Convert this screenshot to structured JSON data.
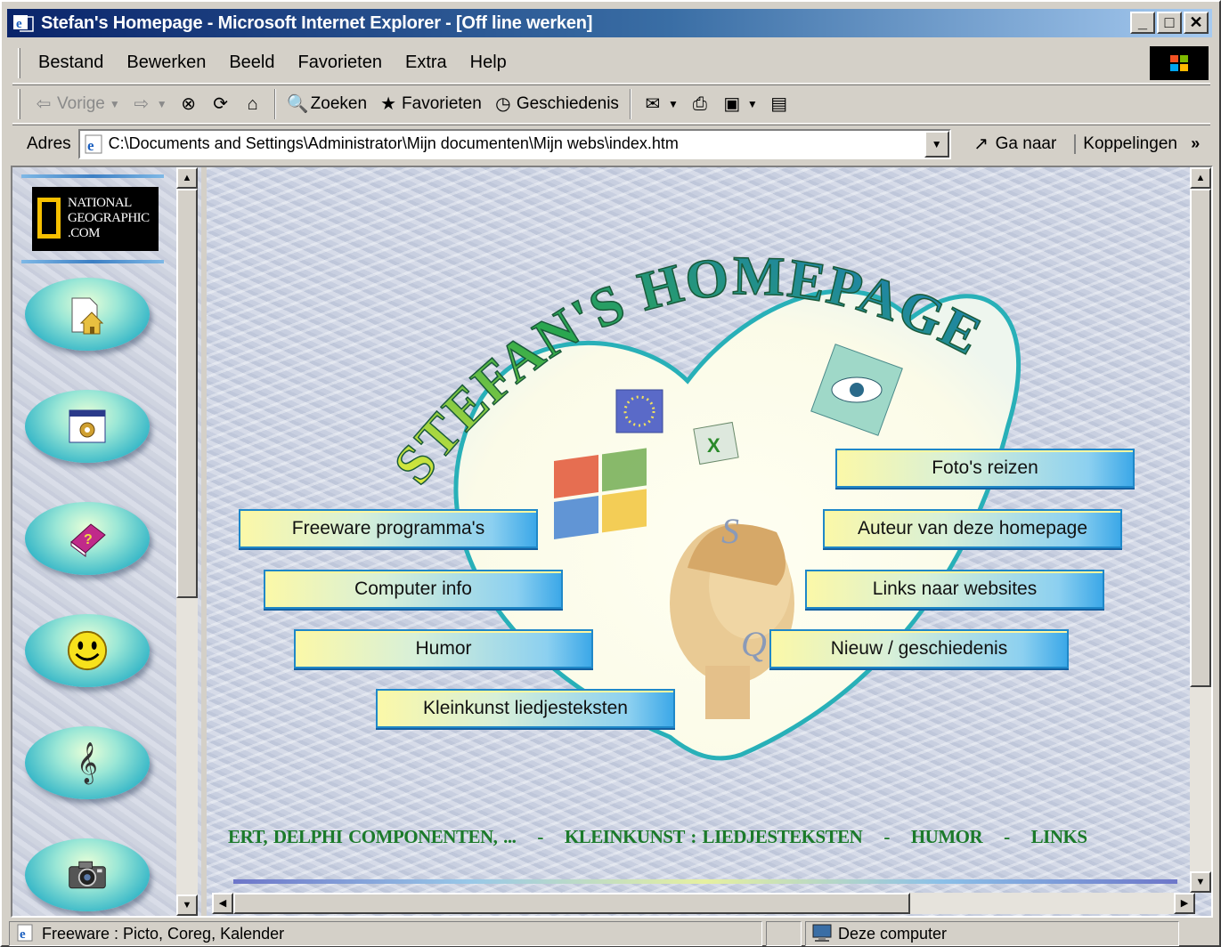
{
  "window": {
    "title": "Stefan's Homepage - Microsoft Internet Explorer - [Off line werken]",
    "controls": [
      "_",
      "□",
      "✕"
    ]
  },
  "menu": [
    "Bestand",
    "Bewerken",
    "Beeld",
    "Favorieten",
    "Extra",
    "Help"
  ],
  "toolbar": {
    "back": "Vorige",
    "search": "Zoeken",
    "favorites": "Favorieten",
    "history": "Geschiedenis"
  },
  "address": {
    "label": "Adres",
    "url": "C:\\Documents and Settings\\Administrator\\Mijn documenten\\Mijn webs\\index.htm",
    "go": "Ga naar",
    "links": "Koppelingen",
    "more": "»"
  },
  "sidebar": {
    "logo_lines": [
      "NATIONAL",
      "GEOGRAPHIC",
      ".COM"
    ],
    "buttons": [
      {
        "icon": "home-icon"
      },
      {
        "icon": "settings-window-icon"
      },
      {
        "icon": "help-book-icon"
      },
      {
        "icon": "smiley-icon"
      },
      {
        "icon": "treble-clef-icon"
      },
      {
        "icon": "camera-icon"
      }
    ]
  },
  "page": {
    "heading": "STEFAN'S HOMEPAGE",
    "left_buttons": [
      "Freeware programma's",
      "Computer info",
      "Humor",
      "Kleinkunst liedjesteksten"
    ],
    "right_buttons": [
      "Foto's reizen",
      "Auteur van deze homepage",
      "Links naar websites",
      "Nieuw / geschiedenis"
    ],
    "marquee": [
      "ERT, DELPHI COMPONENTEN, ...",
      "KLEINKUNST : LIEDJESTEKSTEN",
      "HUMOR",
      "LINKS"
    ],
    "marquee_sep": "-",
    "decor_letters": [
      "S",
      "Q"
    ]
  },
  "status": {
    "text": "Freeware : Picto, Coreg, Kalender",
    "zone": "Deze computer"
  },
  "colors": {
    "titlebar_start": "#0a246a",
    "titlebar_end": "#a6caf0",
    "heading_gradient": [
      "#f2f23a",
      "#2aa84a",
      "#1b78c8"
    ],
    "marquee": "#1b7a2a"
  }
}
